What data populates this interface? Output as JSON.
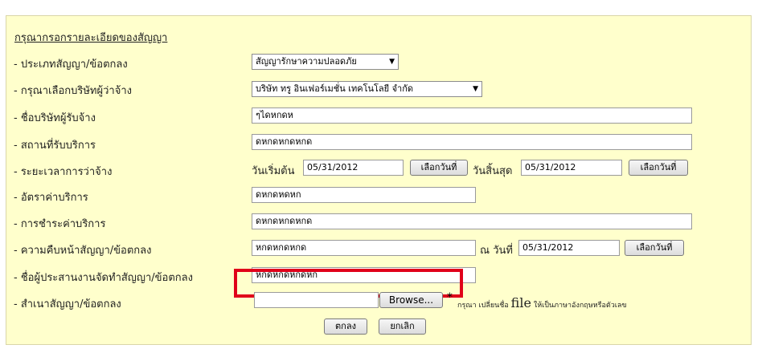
{
  "form": {
    "heading": "กรุณากรอกรายละเอียดของสัญญา",
    "labels": [
      "- ประเภทสัญญา/ข้อตกลง",
      "- กรุณาเลือกบริษัทผู้ว่าจ้าง",
      "- ชื่อบริษัทผู้รับจ้าง",
      "- สถานที่รับบริการ",
      "- ระยะเวลาการว่าจ้าง",
      "- อัตราค่าบริการ",
      "- การชำระค่าบริการ",
      "- ความคืบหน้าสัญญา/ข้อตกลง",
      "- ชื่อผู้ประสานงานจัดทำสัญญา/ข้อตกลง",
      "- สำเนาสัญญา/ข้อตกลง"
    ],
    "contract_type": "สัญญารักษาความปลอดภัย",
    "employer_company": "บริษัท ทรู อินเฟอร์เมชั่น เทคโนโลยี จำกัด",
    "contractor_name": "ๆไดหกดห",
    "service_location": "ดหกดหกดหกด",
    "period": {
      "start_label": "วันเริ่มต้น",
      "start_date": "05/31/2012",
      "end_label": "วันสิ้นสุด",
      "end_date": "05/31/2012"
    },
    "service_rate": "ดหกดหดหก",
    "payment": "ดหกดหกดหกด",
    "progress": {
      "value": "หกดหกดหกด",
      "date_label": "ณ วันที่",
      "date": "05/31/2012"
    },
    "coordinator": "หกดหกดหกดหก",
    "file": {
      "value": "",
      "browse_label": "Browse...",
      "required_mark": "*",
      "note_prefix": "กรุณา เปลี่ยนชื่อ",
      "note_file": "file",
      "note_suffix": "ให้เป็นภาษาอังกฤษหรือตัวเลข"
    },
    "pick_date_label": "เลือกวันที่",
    "submit_label": "ตกลง",
    "cancel_label": "ยกเลิก"
  },
  "colors": {
    "panel_bg": "#ffffcc",
    "highlight": "#e0001a"
  },
  "icons": {
    "dropdown": "chevron-down-icon"
  }
}
